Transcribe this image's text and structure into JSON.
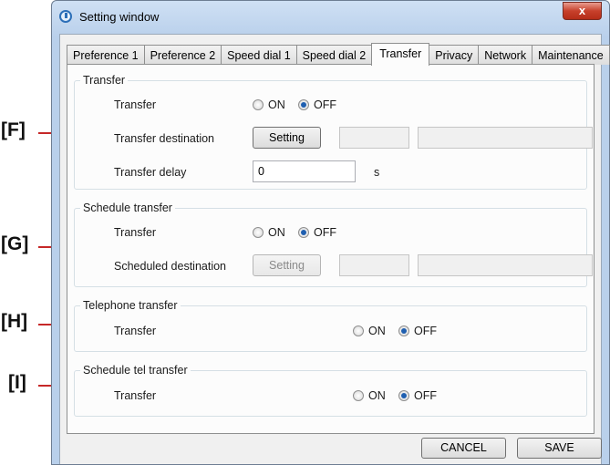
{
  "window": {
    "title": "Setting window",
    "close_glyph": "x"
  },
  "tabs": [
    {
      "label": "Preference 1"
    },
    {
      "label": "Preference 2"
    },
    {
      "label": "Speed dial 1"
    },
    {
      "label": "Speed dial 2"
    },
    {
      "label": "Transfer",
      "active": true
    },
    {
      "label": "Privacy"
    },
    {
      "label": "Network"
    },
    {
      "label": "Maintenance"
    }
  ],
  "callouts": {
    "f": "[F]",
    "g": "[G]",
    "h": "[H]",
    "i": "[I]"
  },
  "transfer_group": {
    "title": "Transfer",
    "transfer_label": "Transfer",
    "on_label": "ON",
    "off_label": "OFF",
    "selected": "OFF",
    "destination_label": "Transfer destination",
    "setting_button": "Setting",
    "delay_label": "Transfer delay",
    "delay_value": "0",
    "delay_unit": "s"
  },
  "schedule_group": {
    "title": "Schedule transfer",
    "transfer_label": "Transfer",
    "on_label": "ON",
    "off_label": "OFF",
    "selected": "OFF",
    "destination_label": "Scheduled destination",
    "setting_button": "Setting"
  },
  "telephone_group": {
    "title": "Telephone transfer",
    "transfer_label": "Transfer",
    "on_label": "ON",
    "off_label": "OFF",
    "selected": "OFF"
  },
  "schedule_tel_group": {
    "title": "Schedule tel transfer",
    "transfer_label": "Transfer",
    "on_label": "ON",
    "off_label": "OFF",
    "selected": "OFF"
  },
  "footer": {
    "cancel_label": "CANCEL",
    "save_label": "SAVE"
  },
  "colors": {
    "callout_line": "#c62828",
    "radio_selected": "#1f5fb0"
  }
}
